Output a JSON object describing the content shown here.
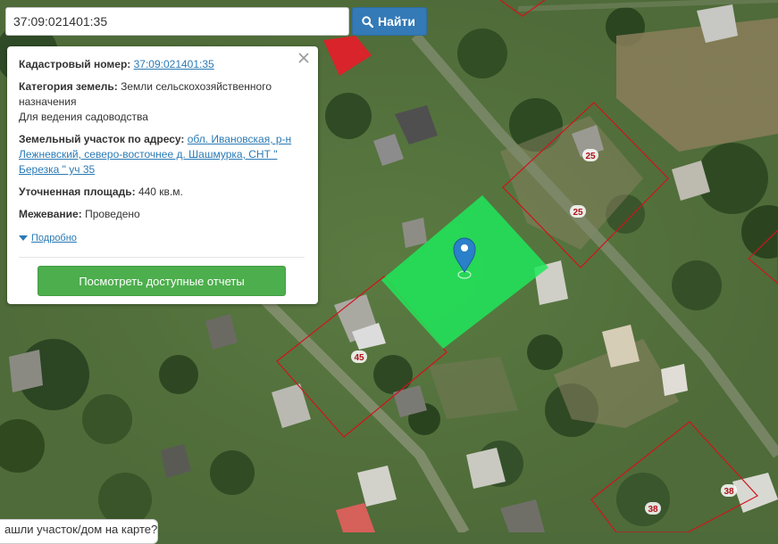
{
  "search": {
    "value": "37:09:021401:35",
    "button_label": "Найти"
  },
  "info": {
    "cadastral_label": "Кадастровый номер:",
    "cadastral_value": "37:09:021401:35",
    "category_label": "Категория земель:",
    "category_value": "Земли сельскохозяйственного назначения",
    "usage_value": "Для ведения садоводства",
    "address_label": "Земельный участок по адресу:",
    "address_value": "обл. Ивановская, р-н Лежневский, северо-восточнее д. Шашмурка, СНТ \" Березка \" уч 35",
    "area_label": "Уточненная площадь:",
    "area_value": "440 кв.м.",
    "survey_label": "Межевание:",
    "survey_value": "Проведено",
    "details_link": "Подробно",
    "reports_button": "Посмотреть доступные отчеты"
  },
  "map": {
    "parcel_labels": {
      "a": "25",
      "b": "25",
      "c": "45",
      "d": "38",
      "e": "38"
    }
  },
  "bottom_bubble": "ашли участок/дом на карте?",
  "colors": {
    "accent_blue": "#337ab7",
    "action_green": "#4cae4c",
    "parcel_highlight": "#1ee85a",
    "parcel_border": "#d0141c",
    "marker_blue": "#2a80c9"
  },
  "icons": [
    "search-icon",
    "close-icon",
    "caret-down-icon",
    "map-pin-icon"
  ]
}
